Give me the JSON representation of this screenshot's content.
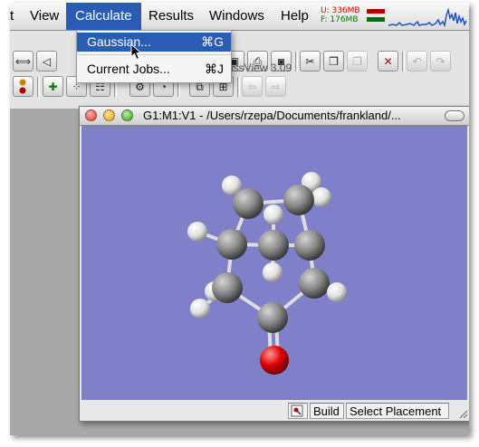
{
  "menubar": {
    "items": [
      "t",
      "View",
      "Calculate",
      "Results",
      "Windows",
      "Help"
    ],
    "active": "Calculate",
    "memory": {
      "used": "U: 336MB",
      "free": "F: 176MB"
    }
  },
  "app_title": "GaussView 3.09",
  "calculate_menu": {
    "items": [
      {
        "label": "Gaussian...",
        "shortcut": "⌘G"
      },
      {
        "label": "Current Jobs...",
        "shortcut": "⌘J"
      }
    ],
    "highlighted": "Gaussian..."
  },
  "window": {
    "title": "G1:M1:V1 - /Users/rzepa/Documents/frankland/...",
    "viewer_background": "#8080ca"
  },
  "statusbar": {
    "cells": [
      "Build",
      "Select Placement"
    ]
  },
  "colors": {
    "menu_highlight": "#2a5cb4",
    "carbon": "#8a8a8a",
    "hydrogen": "#ececec",
    "oxygen": "#e00000"
  }
}
